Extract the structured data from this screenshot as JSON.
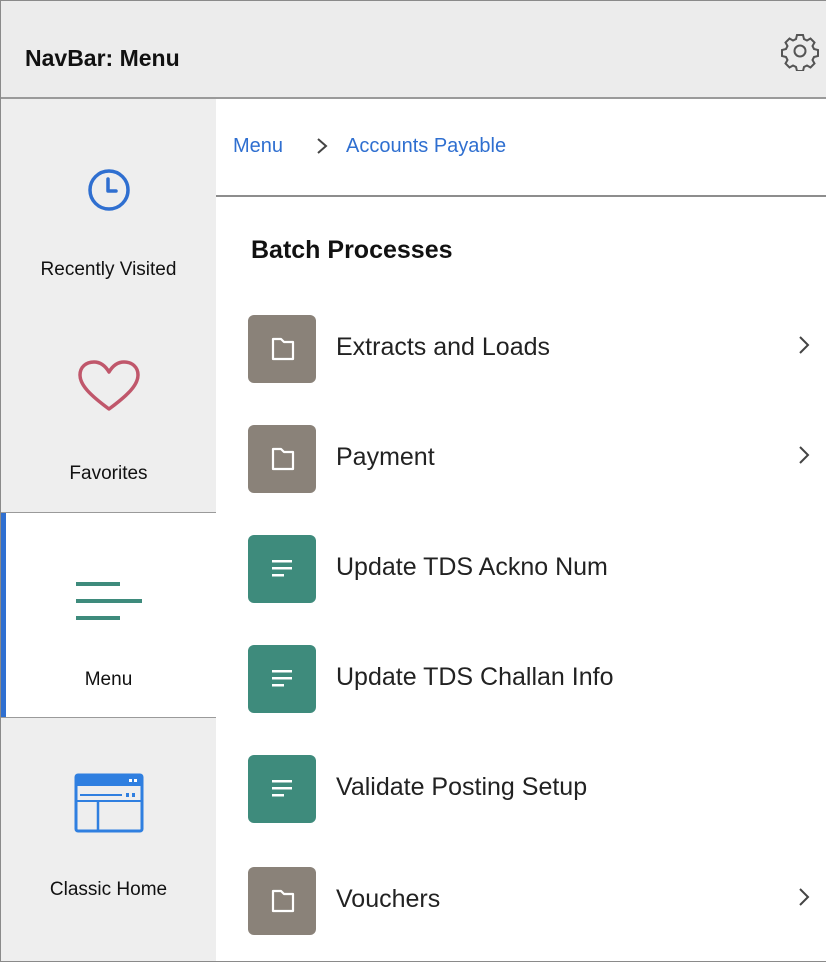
{
  "navbar": {
    "title": "NavBar: Menu",
    "settings_icon": "gear-icon"
  },
  "rail": {
    "items": [
      {
        "label": "Recently Visited",
        "icon": "clock-icon"
      },
      {
        "label": "Favorites",
        "icon": "heart-icon"
      },
      {
        "label": "Menu",
        "icon": "menu-lines-icon",
        "active": true
      },
      {
        "label": "Classic Home",
        "icon": "window-icon"
      }
    ],
    "accent_color": "#2f6fd0"
  },
  "breadcrumb": {
    "items": [
      "Menu",
      "Accounts Payable"
    ],
    "separator": ">"
  },
  "main": {
    "section_title": "Batch Processes",
    "items": [
      {
        "label": "Extracts and Loads",
        "type": "folder",
        "has_chevron": true
      },
      {
        "label": "Payment",
        "type": "folder",
        "has_chevron": true
      },
      {
        "label": "Update TDS Ackno Num",
        "type": "page",
        "has_chevron": false
      },
      {
        "label": "Update TDS Challan Info",
        "type": "page",
        "has_chevron": false
      },
      {
        "label": "Validate Posting Setup",
        "type": "page",
        "has_chevron": false
      },
      {
        "label": "Vouchers",
        "type": "folder",
        "has_chevron": true
      }
    ],
    "folder_color": "#8a8279",
    "page_color": "#3e8b7c"
  }
}
